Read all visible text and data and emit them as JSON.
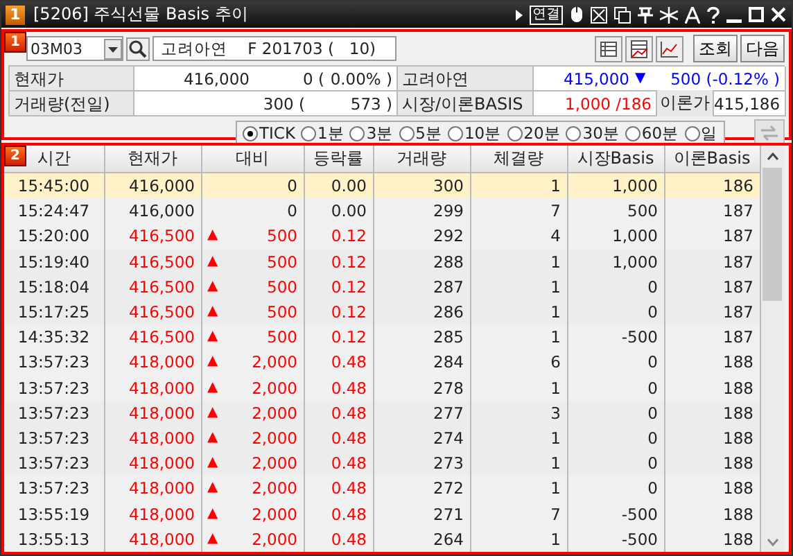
{
  "window": {
    "badge": "1",
    "title": "[5206] 주식선물 Basis 추이",
    "link_button": "연결"
  },
  "panel_1": {
    "badge": "1",
    "code": "03M03",
    "name": "고려아연    F 201703 (   10)",
    "buttons": [
      "조회",
      "다음"
    ]
  },
  "info": {
    "row_1": {
      "label": "현재가",
      "price": "416,000",
      "change": "0 (",
      "rate": "0.00% )",
      "label_2": "고려아연",
      "under_price": "415,000",
      "under_arrow": "▼",
      "under_change": "500 (",
      "under_rate": "-0.12% )"
    },
    "row_2": {
      "label": "거래량(전일)",
      "volume": "300 (",
      "prev_volume": "573 )",
      "label_2": "시장/이론BASIS",
      "market_basis": "1,000 /",
      "theory_basis": "186",
      "label_3": "이론가",
      "theory_price": "415,186"
    }
  },
  "periods": [
    {
      "label": "TICK",
      "selected": true
    },
    {
      "label": "1분",
      "selected": false
    },
    {
      "label": "3분",
      "selected": false
    },
    {
      "label": "5분",
      "selected": false
    },
    {
      "label": "10분",
      "selected": false
    },
    {
      "label": "20분",
      "selected": false
    },
    {
      "label": "30분",
      "selected": false
    },
    {
      "label": "60분",
      "selected": false
    },
    {
      "label": "일",
      "selected": false
    }
  ],
  "panel_2": {
    "badge": "2"
  },
  "table": {
    "columns": [
      "시간",
      "현재가",
      "대비",
      "등락률",
      "거래량",
      "체결량",
      "시장Basis",
      "이론Basis"
    ],
    "rows": [
      {
        "time": "15:45:00",
        "price": "416,000",
        "color": "#222222",
        "change": "0",
        "rate": "0.00",
        "volume": "300",
        "qty": "1",
        "market_basis": "1,000",
        "theory_basis": "186",
        "selected": true
      },
      {
        "time": "15:24:47",
        "price": "416,000",
        "color": "#222222",
        "change": "0",
        "rate": "0.00",
        "volume": "299",
        "qty": "7",
        "market_basis": "500",
        "theory_basis": "187",
        "selected": false
      },
      {
        "time": "15:20:00",
        "price": "416,500",
        "color": "#ff0000",
        "arrow": "▲",
        "change": "500",
        "rate": "0.12",
        "volume": "292",
        "qty": "4",
        "market_basis": "1,000",
        "theory_basis": "187",
        "selected": false
      },
      {
        "time": "15:19:40",
        "price": "416,500",
        "color": "#ff0000",
        "arrow": "▲",
        "change": "500",
        "rate": "0.12",
        "volume": "288",
        "qty": "1",
        "market_basis": "1,000",
        "theory_basis": "187",
        "selected": false
      },
      {
        "time": "15:18:04",
        "price": "416,500",
        "color": "#ff0000",
        "arrow": "▲",
        "change": "500",
        "rate": "0.12",
        "volume": "287",
        "qty": "1",
        "market_basis": "0",
        "theory_basis": "187",
        "selected": false
      },
      {
        "time": "15:17:25",
        "price": "416,500",
        "color": "#ff0000",
        "arrow": "▲",
        "change": "500",
        "rate": "0.12",
        "volume": "286",
        "qty": "1",
        "market_basis": "0",
        "theory_basis": "187",
        "selected": false
      },
      {
        "time": "14:35:32",
        "price": "416,500",
        "color": "#ff0000",
        "arrow": "▲",
        "change": "500",
        "rate": "0.12",
        "volume": "285",
        "qty": "1",
        "market_basis": "-500",
        "theory_basis": "187",
        "selected": false
      },
      {
        "time": "13:57:23",
        "price": "418,000",
        "color": "#ff0000",
        "arrow": "▲",
        "change": "2,000",
        "rate": "0.48",
        "volume": "284",
        "qty": "6",
        "market_basis": "0",
        "theory_basis": "188",
        "selected": false
      },
      {
        "time": "13:57:23",
        "price": "418,000",
        "color": "#ff0000",
        "arrow": "▲",
        "change": "2,000",
        "rate": "0.48",
        "volume": "278",
        "qty": "1",
        "market_basis": "0",
        "theory_basis": "188",
        "selected": false
      },
      {
        "time": "13:57:23",
        "price": "418,000",
        "color": "#ff0000",
        "arrow": "▲",
        "change": "2,000",
        "rate": "0.48",
        "volume": "277",
        "qty": "3",
        "market_basis": "0",
        "theory_basis": "188",
        "selected": false
      },
      {
        "time": "13:57:23",
        "price": "418,000",
        "color": "#ff0000",
        "arrow": "▲",
        "change": "2,000",
        "rate": "0.48",
        "volume": "274",
        "qty": "1",
        "market_basis": "0",
        "theory_basis": "188",
        "selected": false
      },
      {
        "time": "13:57:23",
        "price": "418,000",
        "color": "#ff0000",
        "arrow": "▲",
        "change": "2,000",
        "rate": "0.48",
        "volume": "273",
        "qty": "1",
        "market_basis": "0",
        "theory_basis": "188",
        "selected": false
      },
      {
        "time": "13:57:23",
        "price": "418,000",
        "color": "#ff0000",
        "arrow": "▲",
        "change": "2,000",
        "rate": "0.48",
        "volume": "272",
        "qty": "1",
        "market_basis": "0",
        "theory_basis": "188",
        "selected": false
      },
      {
        "time": "13:55:19",
        "price": "418,000",
        "color": "#ff0000",
        "arrow": "▲",
        "change": "2,000",
        "rate": "0.48",
        "volume": "271",
        "qty": "7",
        "market_basis": "-500",
        "theory_basis": "188",
        "selected": false
      },
      {
        "time": "13:55:13",
        "price": "418,000",
        "color": "#ff0000",
        "arrow": "▲",
        "change": "2,000",
        "rate": "0.48",
        "volume": "264",
        "qty": "1",
        "market_basis": "-500",
        "theory_basis": "188",
        "selected": false
      }
    ]
  }
}
